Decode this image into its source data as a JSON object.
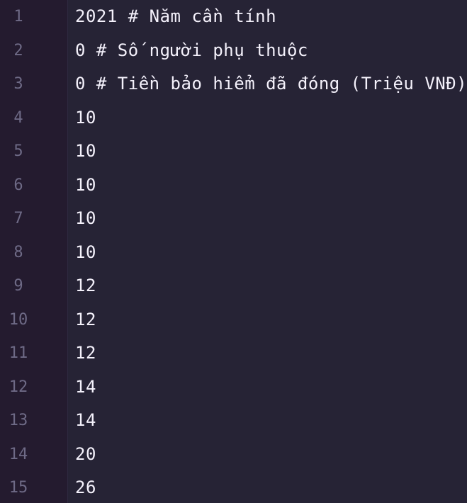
{
  "editor": {
    "lines": [
      {
        "number": "1",
        "code": "2021 # Năm cần tính"
      },
      {
        "number": "2",
        "code": "0 # Số người phụ thuộc"
      },
      {
        "number": "3",
        "code": "0 # Tiền bảo hiểm đã đóng (Triệu VNĐ)"
      },
      {
        "number": "4",
        "code": "10"
      },
      {
        "number": "5",
        "code": "10"
      },
      {
        "number": "6",
        "code": "10"
      },
      {
        "number": "7",
        "code": "10"
      },
      {
        "number": "8",
        "code": "10"
      },
      {
        "number": "9",
        "code": "12"
      },
      {
        "number": "10",
        "code": "12"
      },
      {
        "number": "11",
        "code": "12"
      },
      {
        "number": "12",
        "code": "14"
      },
      {
        "number": "13",
        "code": "14"
      },
      {
        "number": "14",
        "code": "20"
      },
      {
        "number": "15",
        "code": "26"
      }
    ]
  },
  "colors": {
    "background": "#262335",
    "gutter": "#241b2f",
    "line_number": "#6e6a86",
    "text": "#f4f1fb"
  }
}
